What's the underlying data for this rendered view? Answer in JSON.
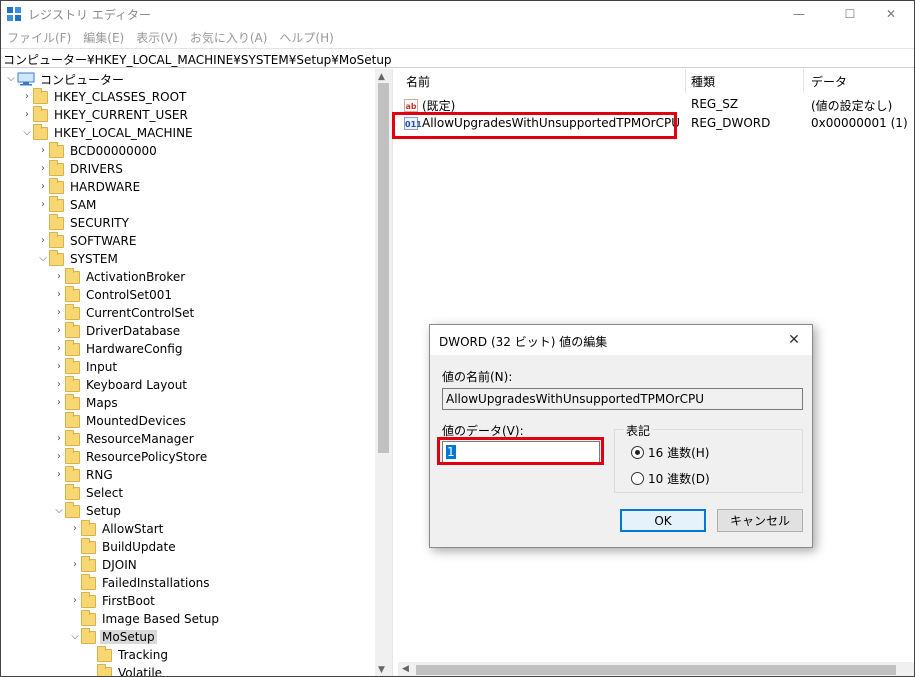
{
  "window": {
    "title": "レジストリ エディター",
    "min_glyph": "—",
    "max_glyph": "☐",
    "close_glyph": "✕"
  },
  "menu": [
    "ファイル(F)",
    "編集(E)",
    "表示(V)",
    "お気に入り(A)",
    "ヘルプ(H)"
  ],
  "address": "コンピューター¥HKEY_LOCAL_MACHINE¥SYSTEM¥Setup¥MoSetup",
  "tree": {
    "root": "コンピューター",
    "items": [
      {
        "label": "HKEY_CLASSES_ROOT",
        "state": "collapsed"
      },
      {
        "label": "HKEY_CURRENT_USER",
        "state": "collapsed"
      },
      {
        "label": "HKEY_LOCAL_MACHINE",
        "state": "expanded"
      },
      {
        "label": "BCD00000000",
        "state": "collapsed"
      },
      {
        "label": "DRIVERS",
        "state": "collapsed"
      },
      {
        "label": "HARDWARE",
        "state": "collapsed"
      },
      {
        "label": "SAM",
        "state": "collapsed"
      },
      {
        "label": "SECURITY",
        "state": "leaf"
      },
      {
        "label": "SOFTWARE",
        "state": "collapsed"
      },
      {
        "label": "SYSTEM",
        "state": "expanded"
      },
      {
        "label": "ActivationBroker",
        "state": "collapsed"
      },
      {
        "label": "ControlSet001",
        "state": "collapsed"
      },
      {
        "label": "CurrentControlSet",
        "state": "collapsed"
      },
      {
        "label": "DriverDatabase",
        "state": "collapsed"
      },
      {
        "label": "HardwareConfig",
        "state": "collapsed"
      },
      {
        "label": "Input",
        "state": "collapsed"
      },
      {
        "label": "Keyboard Layout",
        "state": "collapsed"
      },
      {
        "label": "Maps",
        "state": "collapsed"
      },
      {
        "label": "MountedDevices",
        "state": "leaf"
      },
      {
        "label": "ResourceManager",
        "state": "collapsed"
      },
      {
        "label": "ResourcePolicyStore",
        "state": "collapsed"
      },
      {
        "label": "RNG",
        "state": "collapsed"
      },
      {
        "label": "Select",
        "state": "leaf"
      },
      {
        "label": "Setup",
        "state": "expanded"
      },
      {
        "label": "AllowStart",
        "state": "collapsed"
      },
      {
        "label": "BuildUpdate",
        "state": "leaf"
      },
      {
        "label": "DJOIN",
        "state": "collapsed"
      },
      {
        "label": "FailedInstallations",
        "state": "leaf"
      },
      {
        "label": "FirstBoot",
        "state": "collapsed"
      },
      {
        "label": "Image Based Setup",
        "state": "leaf"
      },
      {
        "label": "MoSetup",
        "state": "expanded",
        "selected": true
      },
      {
        "label": "Tracking",
        "state": "leaf"
      },
      {
        "label": "Volatile",
        "state": "leaf"
      }
    ]
  },
  "list": {
    "headers": {
      "name": "名前",
      "type": "種類",
      "data": "データ"
    },
    "rows": [
      {
        "icon": "ab",
        "name": "(既定)",
        "type": "REG_SZ",
        "data": "(値の設定なし)"
      },
      {
        "icon": "011",
        "name": "AllowUpgradesWithUnsupportedTPMOrCPU",
        "type": "REG_DWORD",
        "data": "0x00000001 (1)"
      }
    ]
  },
  "dialog": {
    "title": "DWORD (32 ビット) 値の編集",
    "close_glyph": "✕",
    "name_label": "値の名前(N):",
    "name_value": "AllowUpgradesWithUnsupportedTPMOrCPU",
    "data_label": "値のデータ(V):",
    "data_value": "1",
    "base_legend": "表記",
    "radio_hex": "16 進数(H)",
    "radio_dec": "10 進数(D)",
    "selected_base": "hex",
    "ok": "OK",
    "cancel": "キャンセル"
  },
  "colors": {
    "highlight": "#e1000f",
    "selection": "#0078d7"
  }
}
